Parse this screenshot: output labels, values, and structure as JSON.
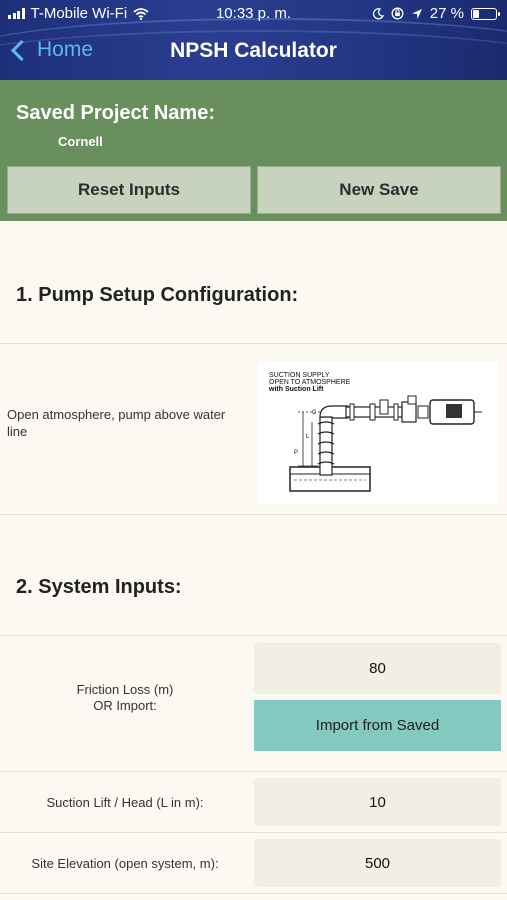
{
  "status_bar": {
    "carrier": "T-Mobile Wi-Fi",
    "time": "10:33 p. m.",
    "battery": "27 %",
    "battery_level": 0.27,
    "icons": [
      "signal-icon",
      "wifi-icon",
      "moon-icon",
      "orientation-lock-icon",
      "location-icon",
      "battery-icon"
    ]
  },
  "nav": {
    "back_label": "Home",
    "title": "NPSH Calculator",
    "accent_color": "#5bb8f4"
  },
  "project": {
    "label": "Saved Project Name:",
    "name": "Cornell",
    "reset_label": "Reset Inputs",
    "new_save_label": "New Save",
    "background_color": "#6a8f5e"
  },
  "pump_setup": {
    "title": "1. Pump Setup Configuration:",
    "description": "Open atmosphere, pump above water line",
    "diagram": {
      "heading_line1": "SUCTION SUPPLY",
      "heading_line2": "OPEN TO ATMOSPHERE",
      "heading_line3": "with Suction Lift"
    }
  },
  "system_inputs": {
    "title": "2. System Inputs:",
    "friction_label_line1": "Friction Loss (m)",
    "friction_label_line2": "OR Import:",
    "friction_value": "80",
    "import_label": "Import from Saved",
    "suction_label": "Suction Lift / Head (L in m):",
    "suction_value": "10",
    "elevation_label": "Site Elevation (open system, m):",
    "elevation_value": "500",
    "import_color": "#84c9c0"
  }
}
